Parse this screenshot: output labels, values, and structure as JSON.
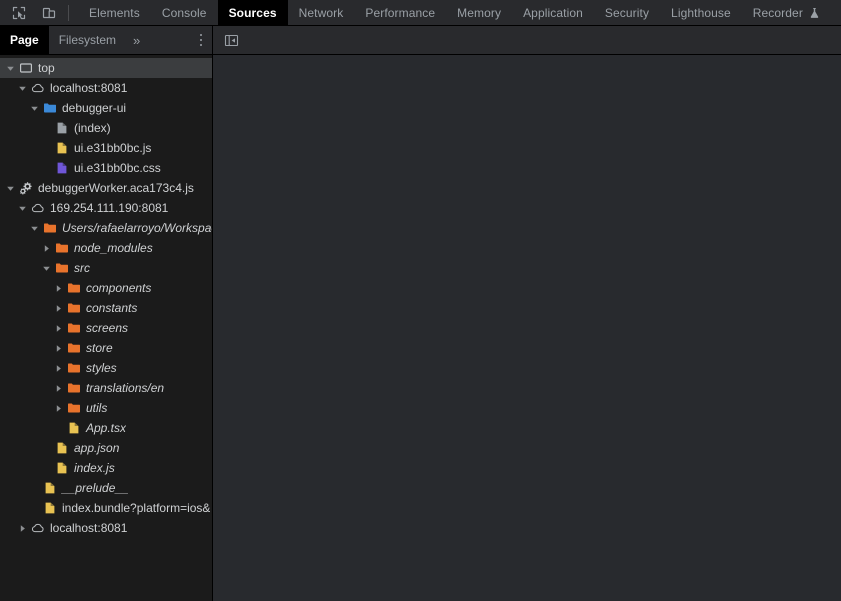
{
  "toolbar": {
    "inspect_icon": "inspect-element-icon",
    "device_icon": "device-toolbar-icon",
    "tabs": [
      {
        "label": "Elements",
        "active": false,
        "flask": false
      },
      {
        "label": "Console",
        "active": false,
        "flask": false
      },
      {
        "label": "Sources",
        "active": true,
        "flask": false
      },
      {
        "label": "Network",
        "active": false,
        "flask": false
      },
      {
        "label": "Performance",
        "active": false,
        "flask": false
      },
      {
        "label": "Memory",
        "active": false,
        "flask": false
      },
      {
        "label": "Application",
        "active": false,
        "flask": false
      },
      {
        "label": "Security",
        "active": false,
        "flask": false
      },
      {
        "label": "Lighthouse",
        "active": false,
        "flask": false
      },
      {
        "label": "Recorder",
        "active": false,
        "flask": true
      }
    ]
  },
  "navigator": {
    "tabs": [
      {
        "label": "Page",
        "active": true
      },
      {
        "label": "Filesystem",
        "active": false
      }
    ],
    "overflow_label": "»",
    "more_options_icon": "vertical-dots-icon",
    "tree": [
      {
        "label": "top",
        "depth": 0,
        "twisty": "expanded",
        "icon": "frame",
        "italic": false,
        "selected": true
      },
      {
        "label": "localhost:8081",
        "depth": 1,
        "twisty": "expanded",
        "icon": "cloud",
        "italic": false,
        "selected": false
      },
      {
        "label": "debugger-ui",
        "depth": 2,
        "twisty": "expanded",
        "icon": "folder-blue",
        "italic": false,
        "selected": false
      },
      {
        "label": "(index)",
        "depth": 3,
        "twisty": "none",
        "icon": "doc-gray",
        "italic": false,
        "selected": false
      },
      {
        "label": "ui.e31bb0bc.js",
        "depth": 3,
        "twisty": "none",
        "icon": "doc-yellow",
        "italic": false,
        "selected": false
      },
      {
        "label": "ui.e31bb0bc.css",
        "depth": 3,
        "twisty": "none",
        "icon": "doc-purple",
        "italic": false,
        "selected": false
      },
      {
        "label": "debuggerWorker.aca173c4.js",
        "depth": 0,
        "twisty": "expanded",
        "icon": "worker",
        "italic": false,
        "selected": false
      },
      {
        "label": "169.254.111.190:8081",
        "depth": 1,
        "twisty": "expanded",
        "icon": "cloud",
        "italic": false,
        "selected": false
      },
      {
        "label": "Users/rafaelarroyo/Workspac",
        "depth": 2,
        "twisty": "expanded",
        "icon": "folder-orange",
        "italic": true,
        "selected": false
      },
      {
        "label": "node_modules",
        "depth": 3,
        "twisty": "collapsed",
        "icon": "folder-orange",
        "italic": true,
        "selected": false
      },
      {
        "label": "src",
        "depth": 3,
        "twisty": "expanded",
        "icon": "folder-orange",
        "italic": true,
        "selected": false
      },
      {
        "label": "components",
        "depth": 4,
        "twisty": "collapsed",
        "icon": "folder-orange",
        "italic": true,
        "selected": false
      },
      {
        "label": "constants",
        "depth": 4,
        "twisty": "collapsed",
        "icon": "folder-orange",
        "italic": true,
        "selected": false
      },
      {
        "label": "screens",
        "depth": 4,
        "twisty": "collapsed",
        "icon": "folder-orange",
        "italic": true,
        "selected": false
      },
      {
        "label": "store",
        "depth": 4,
        "twisty": "collapsed",
        "icon": "folder-orange",
        "italic": true,
        "selected": false
      },
      {
        "label": "styles",
        "depth": 4,
        "twisty": "collapsed",
        "icon": "folder-orange",
        "italic": true,
        "selected": false
      },
      {
        "label": "translations/en",
        "depth": 4,
        "twisty": "collapsed",
        "icon": "folder-orange",
        "italic": true,
        "selected": false
      },
      {
        "label": "utils",
        "depth": 4,
        "twisty": "collapsed",
        "icon": "folder-orange",
        "italic": true,
        "selected": false
      },
      {
        "label": "App.tsx",
        "depth": 4,
        "twisty": "none",
        "icon": "doc-yellow",
        "italic": true,
        "selected": false
      },
      {
        "label": "app.json",
        "depth": 3,
        "twisty": "none",
        "icon": "doc-yellow",
        "italic": true,
        "selected": false
      },
      {
        "label": "index.js",
        "depth": 3,
        "twisty": "none",
        "icon": "doc-yellow",
        "italic": true,
        "selected": false
      },
      {
        "label": "__prelude__",
        "depth": 2,
        "twisty": "none",
        "icon": "doc-yellow",
        "italic": true,
        "selected": false
      },
      {
        "label": "index.bundle?platform=ios&",
        "depth": 2,
        "twisty": "none",
        "icon": "doc-yellow",
        "italic": false,
        "selected": false
      },
      {
        "label": "localhost:8081",
        "depth": 1,
        "twisty": "collapsed",
        "icon": "cloud",
        "italic": false,
        "selected": false
      }
    ]
  },
  "editor": {
    "show_navigator_icon": "panel-collapse-icon",
    "content": ""
  },
  "colors": {
    "tab_active_bg": "#000000",
    "tab_text": "#9aa0a6",
    "folder_blue": "#3b89d8",
    "folder_orange": "#e8732c",
    "doc_yellow": "#e8c252",
    "doc_purple": "#6f56d8",
    "doc_gray": "#9aa0a6",
    "sidebar_bg": "#1b1b1b",
    "editor_bg": "#282a2e",
    "toolbar_bg": "#292a2d"
  }
}
